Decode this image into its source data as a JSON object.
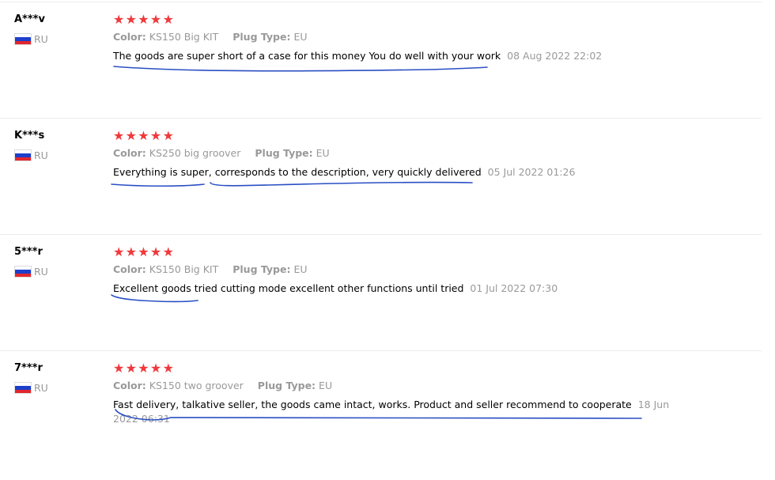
{
  "reviews": [
    {
      "user": "A***v",
      "country": "RU",
      "stars": "★★★★★",
      "color_label": "Color:",
      "color_value": "KS150 Big KIT",
      "plug_label": "Plug Type:",
      "plug_value": "EU",
      "text": "The goods are super short of a case for this money You do well with your work",
      "date": "08 Aug 2022 22:02"
    },
    {
      "user": "K***s",
      "country": "RU",
      "stars": "★★★★★",
      "color_label": "Color:",
      "color_value": "KS250 big groover",
      "plug_label": "Plug Type:",
      "plug_value": "EU",
      "text": "Everything is super, corresponds to the description, very quickly delivered",
      "date": "05 Jul 2022 01:26"
    },
    {
      "user": "5***r",
      "country": "RU",
      "stars": "★★★★★",
      "color_label": "Color:",
      "color_value": "KS150 Big KIT",
      "plug_label": "Plug Type:",
      "plug_value": "EU",
      "text": "Excellent goods tried cutting mode excellent other functions until tried",
      "date": "01 Jul 2022 07:30"
    },
    {
      "user": "7***r",
      "country": "RU",
      "stars": "★★★★★",
      "color_label": "Color:",
      "color_value": "KS150 two groover",
      "plug_label": "Plug Type:",
      "plug_value": "EU",
      "text": "Fast delivery, talkative seller, the goods came intact, works. Product and seller recommend to cooperate",
      "date": "18 Jun 2022 06:31"
    }
  ],
  "colors": {
    "star": "#f0393c",
    "annotation": "#2a4fc4",
    "muted": "#999999"
  },
  "icons": {
    "star": "star-icon",
    "flag": "flag-ru-icon"
  }
}
